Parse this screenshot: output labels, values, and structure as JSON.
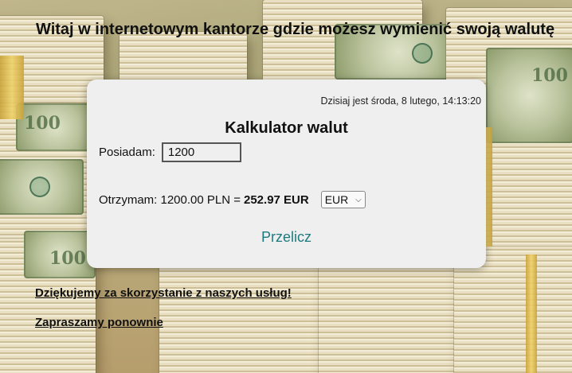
{
  "header": {
    "welcome": "Witaj w internetowym kantorze gdzie możesz wymienić swoją walutę"
  },
  "calculator": {
    "date_text": "Dzisiaj jest środa, 8 lutego, 14:13:20",
    "title": "Kalkulator walut",
    "have_label": "Posiadam:",
    "have_value": "1200",
    "get_label": "Otrzymam: 1200.00 PLN =",
    "get_amount": "252.97 EUR",
    "currency_selected": "EUR",
    "convert_label": "Przelicz"
  },
  "footer": {
    "thanks_link": "Dziękujemy za skorzystanie z naszych usług!",
    "invite_link": "Zapraszamy ponownie"
  },
  "icons": {
    "select": "chevron-down-icon"
  },
  "colors": {
    "card_bg": "#efefef",
    "button_text": "#1d7b80",
    "background": "#c9b98f"
  }
}
